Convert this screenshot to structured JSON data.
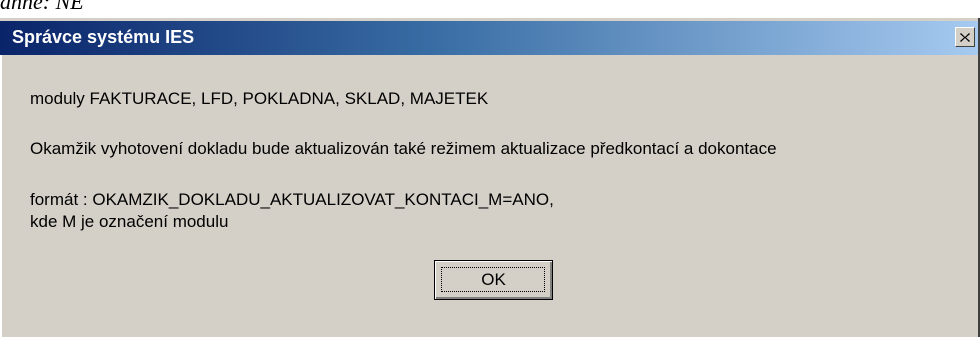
{
  "document": {
    "fragment_text": "ahne: NE"
  },
  "dialog": {
    "title": "Správce systému IES",
    "close_icon": "close-icon",
    "title_colors": [
      "#0a246a",
      "#a6caf0"
    ],
    "background_color": "#d4d0c8",
    "message": {
      "line1": "moduly FAKTURACE, LFD, POKLADNA, SKLAD, MAJETEK",
      "line2": "Okamžik vyhotovení dokladu bude aktualizován také režimem aktualizace předkontací a dokontace",
      "line3": "formát : OKAMZIK_DOKLADU_AKTUALIZOVAT_KONTACI_M=ANO,",
      "line4": "kde M je označení modulu"
    },
    "ok_label": "OK"
  }
}
